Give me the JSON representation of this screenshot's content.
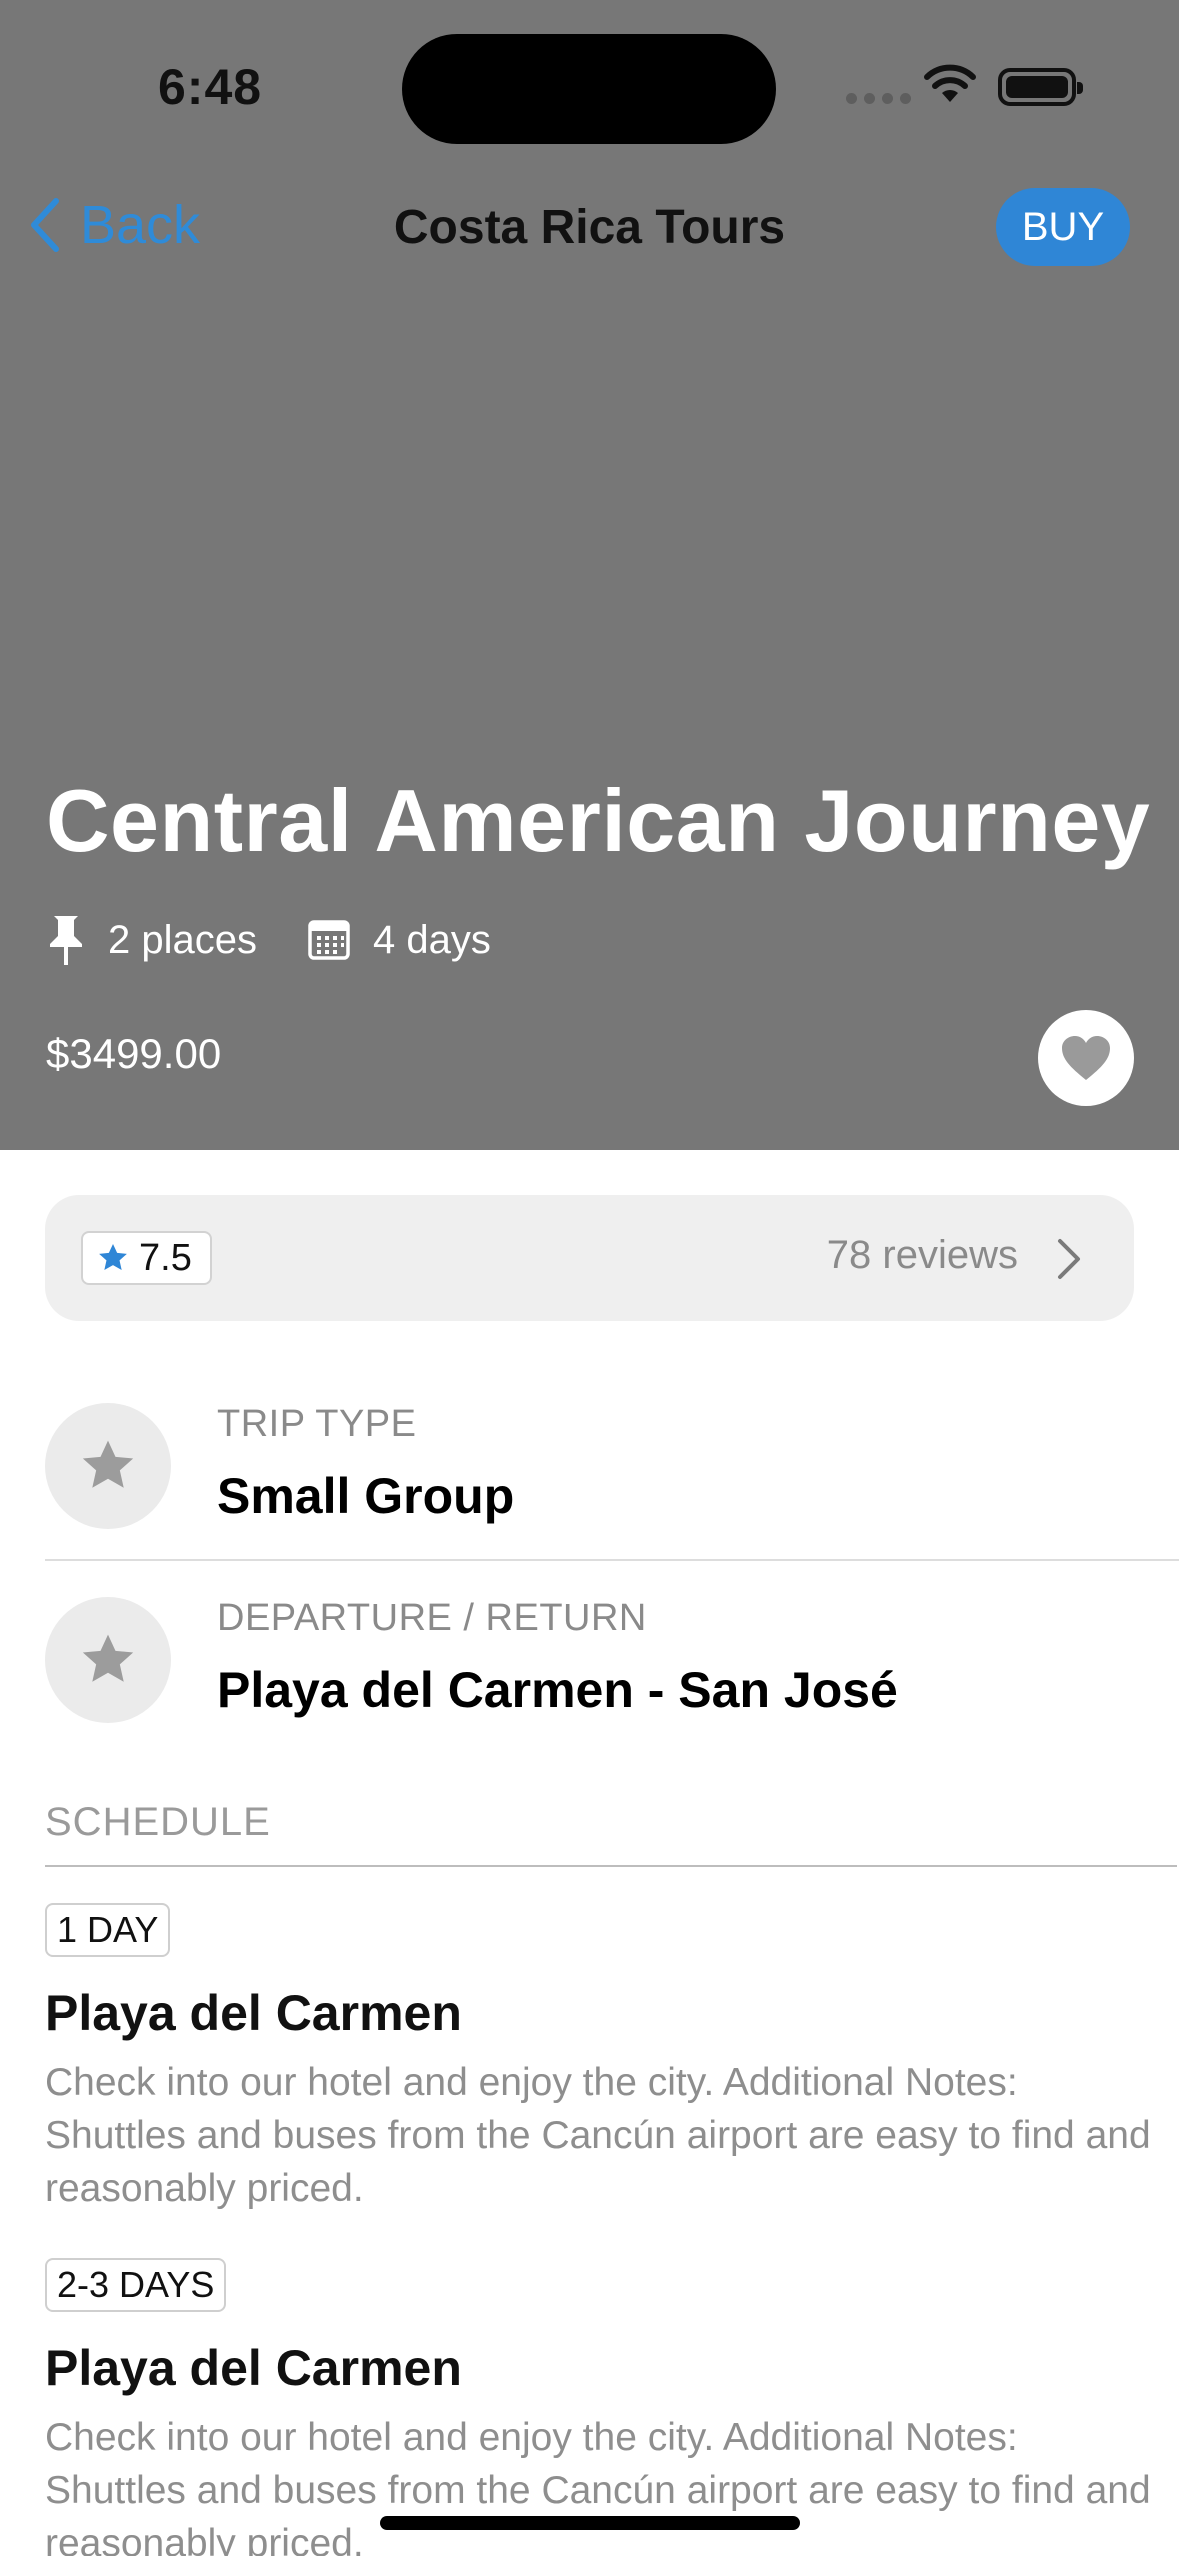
{
  "status_bar": {
    "time": "6:48"
  },
  "nav": {
    "back_label": "Back",
    "title": "Costa Rica Tours",
    "buy_label": "BUY"
  },
  "hero": {
    "title": "Central American Journey",
    "places": "2 places",
    "days": "4 days",
    "price": "$3499.00"
  },
  "reviews": {
    "rating": "7.5",
    "count_label": "78 reviews"
  },
  "info": [
    {
      "label": "TRIP TYPE",
      "value": "Small Group"
    },
    {
      "label": "DEPARTURE / RETURN",
      "value": "Playa del Carmen - San José"
    }
  ],
  "schedule": {
    "heading": "SCHEDULE",
    "items": [
      {
        "tag": "1 DAY",
        "title": "Playa del Carmen",
        "description": "Check into our hotel and enjoy the city. Additional Notes: Shuttles and buses from the Cancún airport are easy to find and reasonably priced."
      },
      {
        "tag": "2-3 DAYS",
        "title": "Playa del Carmen",
        "description": "Check into our hotel and enjoy the city. Additional Notes: Shuttles and buses from the Cancún airport are easy to find and reasonably priced."
      }
    ]
  },
  "colors": {
    "accent": "#2f86d6",
    "hero_bg": "#777777",
    "muted_text": "#8a8a8a"
  },
  "icons": [
    "chevron-left-icon",
    "wifi-icon",
    "battery-icon",
    "pin-icon",
    "calendar-icon",
    "heart-icon",
    "star-icon",
    "chevron-right-icon"
  ]
}
